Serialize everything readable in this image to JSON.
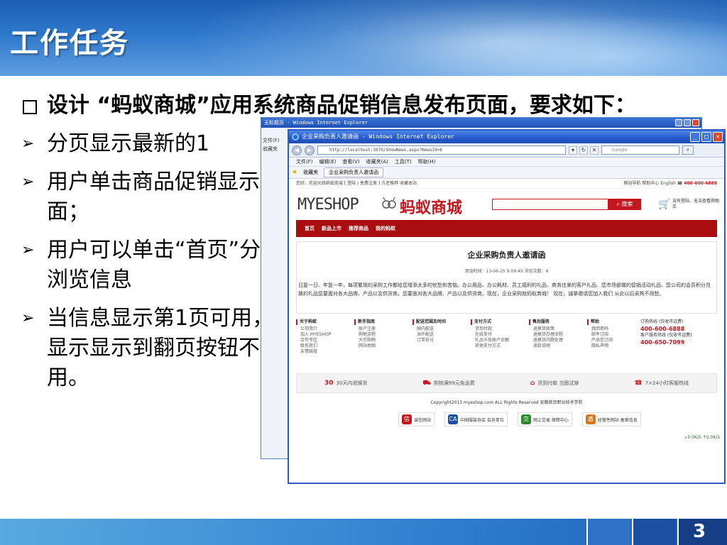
{
  "slide": {
    "title": "工作任务",
    "page_number": "3",
    "main_point": "设计 “蚂蚁商城”应用系统商品促销信息发布页面，要求如下：",
    "sub_points": [
      "分页显示最新的1",
      "用户单击商品促销显示页面；",
      "用户可以单击“首页”分页浏览信息",
      "当信息显示第1页可用，显示显示到翻页按钮不可用。"
    ]
  },
  "back_window": {
    "title": "无标题页 - Windows Internet Explorer",
    "side_items": [
      "文件(F)",
      "收藏夹"
    ]
  },
  "browser": {
    "title": "企业采购负责人邀请函 - Windows Internet Explorer",
    "address": "http://localhost:3070/ShowNews.aspx?NewsId=6",
    "search_placeholder": "Google",
    "menu": [
      "文件(F)",
      "编辑(E)",
      "查看(V)",
      "收藏夹(A)",
      "工具(T)",
      "帮助(H)"
    ],
    "favorites_label": "收藏夹",
    "tab_label": "企业采购负责人邀请函",
    "colors": {
      "title_bar": "#2458c9",
      "close": "#d8482c"
    }
  },
  "site": {
    "top_left": "您好，欢迎光临蚂蚁商城 [ 登陆 | 免费注册 ] 方还推荐 收藏本站",
    "top_right": "网站导航 帮助中心 English",
    "phone": "400-600-6888",
    "logo_en": "MYESHOP",
    "logo_cn": "蚂蚁商城",
    "search_button": "搜索",
    "cart_text": "没有登陆，无法查看购物车",
    "nav": [
      "首页",
      "新品上市",
      "推荐商品",
      "我的蚂蚁"
    ],
    "article": {
      "title": "企业采购负责人邀请函",
      "meta": "添加时间：13-06-25 9:09:45 浏览次数：6",
      "body": "日复一日、年复一年，每项繁琐的采购工作都给您增添太多的忧愁和苦恼。办公用品、办公耗材、员工福利的礼品、商务往来的客户礼品、您市场部做的促销活动礼品、您公司的会员积分兑换的礼品您要面对各大品牌、产品以及供货商。您要面对各大品牌、产品以及供货商。现在，企业采购就蚂蚁商城！ 现在，诚挚邀请您加入我们 从此以后采购不用愁。"
    },
    "footer_columns": [
      {
        "heading": "关于蚂蚁",
        "items": [
          "公司简介",
          "加入 MYESHOP",
          "合作专区",
          "联系我们",
          "友情链接"
        ]
      },
      {
        "heading": "新手指南",
        "items": [
          "账户注册",
          "购物流程",
          "大宗购物",
          "网站地图"
        ]
      },
      {
        "heading": "配送范围及时间",
        "items": [
          "国内配送",
          "海外配送",
          "订单拆分"
        ]
      },
      {
        "heading": "支付方式",
        "items": [
          "货到付款",
          "在线支付",
          "礼品卡及账户余额",
          "其他支付方式"
        ]
      },
      {
        "heading": "售后服务",
        "items": [
          "退换货政策",
          "退换货办理流程",
          "退换货问题处理",
          "退款说明"
        ]
      },
      {
        "heading": "帮助",
        "items": [
          "找回密码",
          "邮件订阅",
          "产品信订阅",
          "隐私声明"
        ]
      }
    ],
    "hotline": {
      "order_label": "订购热线 (仅收市话费)",
      "order_number": "400-600-6888",
      "service_label": "客户服务热线 (仅收市话费)",
      "service_number": "400-650-7099"
    },
    "services": [
      {
        "icon": "30",
        "text": "30天内退换货"
      },
      {
        "icon": "⛟",
        "text": "购物满99元免运费"
      },
      {
        "icon": "⌂",
        "text": "货到付款 当面试穿"
      },
      {
        "icon": "☎",
        "text": "7×24小时客服热线"
      }
    ],
    "copyright": "Copyright2013 myeshop.com ALL Rights Reserved 安徽商贸职业技术学院",
    "badges": [
      {
        "icon": "信",
        "text": "诚信网站"
      },
      {
        "icon": "CA",
        "text": "中国服装协会 会员单位"
      },
      {
        "icon": "交",
        "text": "网上交易 保障中心"
      },
      {
        "icon": "盾",
        "text": "经营性网站 备案信息"
      }
    ],
    "status": "↓0.0K/S ↑0.0K/S"
  }
}
